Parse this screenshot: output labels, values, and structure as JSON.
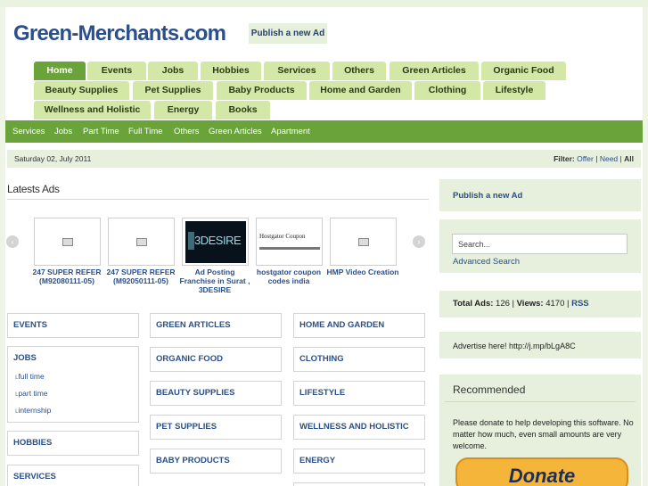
{
  "header": {
    "logo": "Green-Merchants.com",
    "publish_button": "Publish a new Ad"
  },
  "main_tabs": [
    "Home",
    "Events",
    "Jobs",
    "Hobbies",
    "Services",
    "Others",
    "Green Articles",
    "Organic Food",
    "Beauty Supplies",
    "Pet Supplies",
    "Baby Products",
    "Home and Garden",
    "Clothing",
    "Lifestyle",
    "Wellness and Holistic",
    "Energy",
    "Books"
  ],
  "sub_nav": [
    "Services",
    "Jobs",
    "Part Time",
    "Full Time",
    "Others",
    "Green Articles",
    "Apartment"
  ],
  "date_bar": {
    "date": "Saturday 02, July 2011",
    "filter_label": "Filter:",
    "filter_offer": "Offer",
    "filter_sep1": "|",
    "filter_need": "Need",
    "filter_sep2": "|",
    "filter_all": "All"
  },
  "latest_ads": {
    "title": "Latests Ads",
    "prev_icon": "‹",
    "next_icon": "›",
    "items": [
      {
        "caption": "247 SUPER REFER (M92080111-05)"
      },
      {
        "caption": "247 SUPER REFER (M92050111-05)"
      },
      {
        "caption": "Ad Posting Franchise in Surat , 3DESIRE",
        "thumb_text": "3DESIRE"
      },
      {
        "caption": "hostgator coupon codes india",
        "thumb_text": "Hostgator Coupon"
      },
      {
        "caption": "HMP Video Creation"
      }
    ]
  },
  "categories": {
    "col1": [
      {
        "title": "EVENTS",
        "subs": []
      },
      {
        "title": "JOBS",
        "subs": [
          "full time",
          "part time",
          "internship"
        ]
      },
      {
        "title": "HOBBIES",
        "subs": []
      },
      {
        "title": "SERVICES",
        "subs": []
      }
    ],
    "col2": [
      "GREEN ARTICLES",
      "ORGANIC FOOD",
      "BEAUTY SUPPLIES",
      "PET SUPPLIES",
      "BABY PRODUCTS"
    ],
    "col3": [
      "HOME AND GARDEN",
      "CLOTHING",
      "LIFESTYLE",
      "WELLNESS AND HOLISTIC",
      "ENERGY"
    ]
  },
  "sub_marker": "ʟ",
  "sidebar": {
    "publish_link": "Publish a new Ad",
    "search_value": "Search...",
    "advanced_search": "Advanced Search",
    "total_ads_label": "Total Ads:",
    "total_ads": "126",
    "views_label": "Views:",
    "views": "4170",
    "rss": "RSS",
    "advert_text": "Advertise here! http://j.mp/bLgA8C",
    "recommended_title": "Recommended",
    "recommended_text": "Please donate to help developing this software. No matter how much, even small amounts are very welcome.",
    "donate_label": "Donate"
  }
}
